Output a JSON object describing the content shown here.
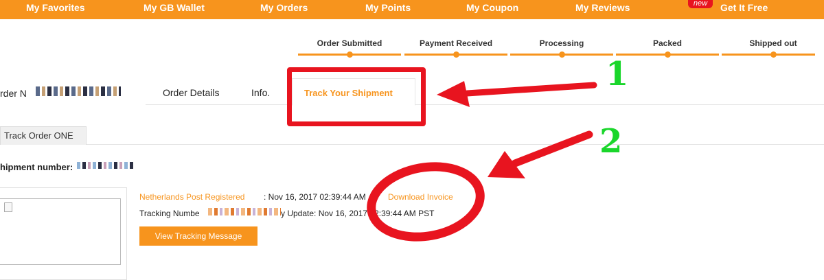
{
  "topnav": {
    "items": [
      "My Favorites",
      "My GB Wallet",
      "My Orders",
      "My Points",
      "My Coupon",
      "My Reviews",
      "Get It Free"
    ],
    "new_badge": "new"
  },
  "progress": {
    "steps": [
      "Order Submitted",
      "Payment Received",
      "Processing",
      "Packed",
      "Shipped out"
    ]
  },
  "order": {
    "label": "rder N"
  },
  "tabs": {
    "details": "Order Details",
    "info": "Info.",
    "track": "Track Your Shipment"
  },
  "track_tab": {
    "label": "Track Order ONE"
  },
  "shipment": {
    "label": "hipment number:"
  },
  "tracking": {
    "carrier": "Netherlands Post Registered",
    "date": ": Nov 16, 2017 02:39:44 AM",
    "download_label": "Download Invoice",
    "number_label": "Tracking Numbe",
    "update_text": "y Update: Nov 16, 2017 02:39:44 AM PST",
    "view_button": "View Tracking Message"
  },
  "annotations": {
    "mark_1": "1",
    "mark_2": "2"
  },
  "colors": {
    "accent": "#f7941d",
    "annotation_red": "#e8141f",
    "annotation_green": "#1ad62b"
  }
}
